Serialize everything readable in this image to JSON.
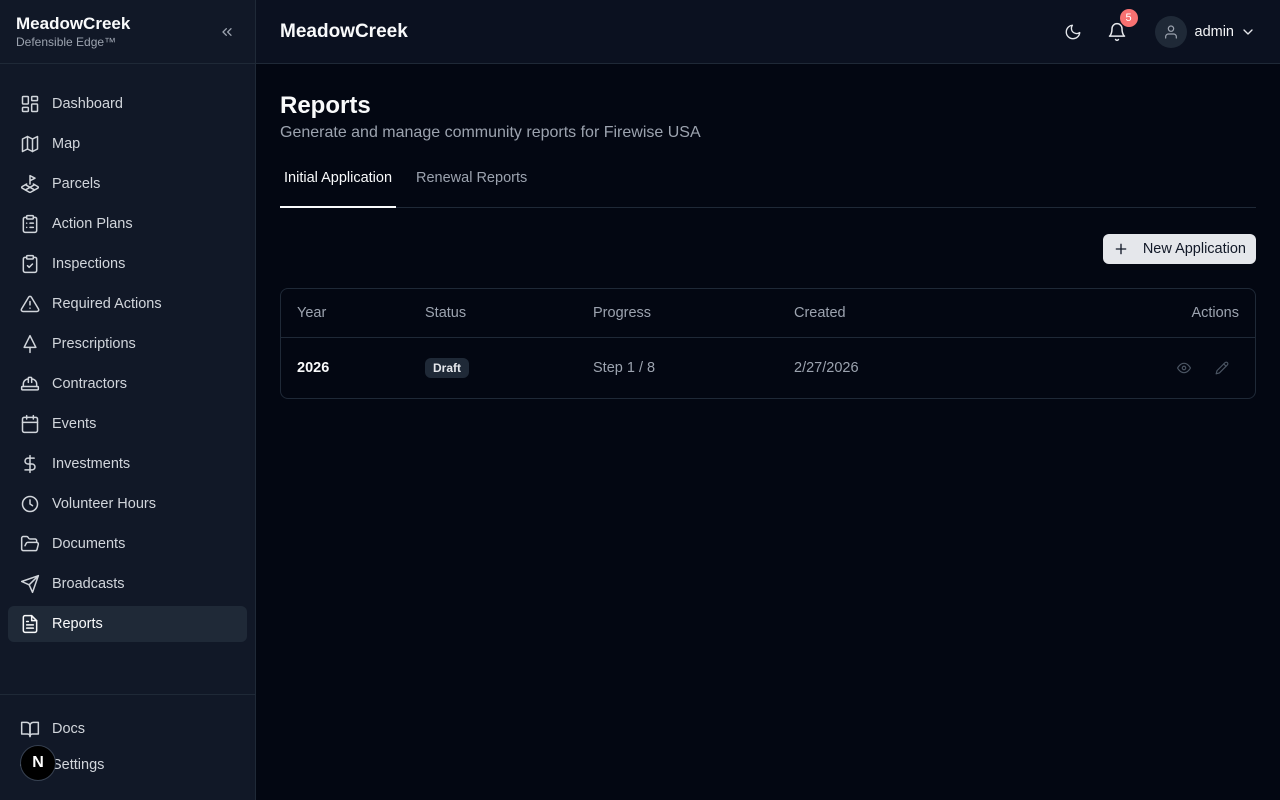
{
  "brand": {
    "name": "MeadowCreek",
    "subtitle": "Defensible Edge™"
  },
  "sidebar": {
    "items": [
      {
        "label": "Dashboard",
        "icon": "layout-dashboard-icon"
      },
      {
        "label": "Map",
        "icon": "map-icon"
      },
      {
        "label": "Parcels",
        "icon": "land-plot-icon"
      },
      {
        "label": "Action Plans",
        "icon": "clipboard-list-icon"
      },
      {
        "label": "Inspections",
        "icon": "clipboard-check-icon"
      },
      {
        "label": "Required Actions",
        "icon": "alert-triangle-icon"
      },
      {
        "label": "Prescriptions",
        "icon": "tree-icon"
      },
      {
        "label": "Contractors",
        "icon": "hard-hat-icon"
      },
      {
        "label": "Events",
        "icon": "calendar-icon"
      },
      {
        "label": "Investments",
        "icon": "dollar-icon"
      },
      {
        "label": "Volunteer Hours",
        "icon": "clock-icon"
      },
      {
        "label": "Documents",
        "icon": "folder-open-icon"
      },
      {
        "label": "Broadcasts",
        "icon": "send-icon"
      },
      {
        "label": "Reports",
        "icon": "file-text-icon",
        "active": true
      }
    ],
    "bottom": [
      {
        "label": "Docs",
        "icon": "book-open-icon"
      },
      {
        "label": "Settings",
        "icon": "settings-icon"
      }
    ],
    "dev_badge": "N"
  },
  "topbar": {
    "title": "MeadowCreek",
    "notifications_count": "5",
    "user": "admin"
  },
  "page": {
    "title": "Reports",
    "subtitle": "Generate and manage community reports for Firewise USA",
    "tabs": [
      {
        "label": "Initial Application",
        "active": true
      },
      {
        "label": "Renewal Reports",
        "active": false
      }
    ],
    "new_button": "New Application"
  },
  "table": {
    "columns": [
      "Year",
      "Status",
      "Progress",
      "Created",
      "Actions"
    ],
    "rows": [
      {
        "year": "2026",
        "status": "Draft",
        "progress": "Step 1 / 8",
        "created": "2/27/2026"
      }
    ]
  },
  "colors": {
    "background": "#030712",
    "sidebar": "#111827",
    "accent": "#e5e7eb",
    "notification": "#f87171"
  }
}
